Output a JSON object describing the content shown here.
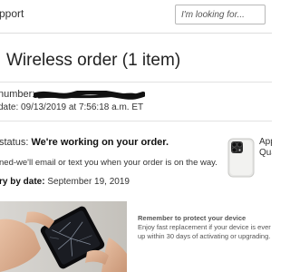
{
  "header": {
    "support_link": "pport",
    "search_placeholder": "I'm looking for..."
  },
  "main": {
    "title": "Wireless order (1 item)",
    "order_number_label": "number:",
    "order_date": "date: 09/13/2019 at 7:56:18 a.m. ET",
    "status_label": "status:",
    "status_value": "We're working on your order.",
    "status_note": "ned-we'll email or text you when your order is on the way.",
    "delivery_label": "ry by date:",
    "delivery_value": "September 19, 2019",
    "product": {
      "name": "App",
      "qty": "Qua"
    }
  },
  "promo": {
    "heading": "Remember to protect your device",
    "line1": "Enjoy fast replacement if your device is ever lo",
    "line2": "up within 30 days of activating or upgrading."
  }
}
